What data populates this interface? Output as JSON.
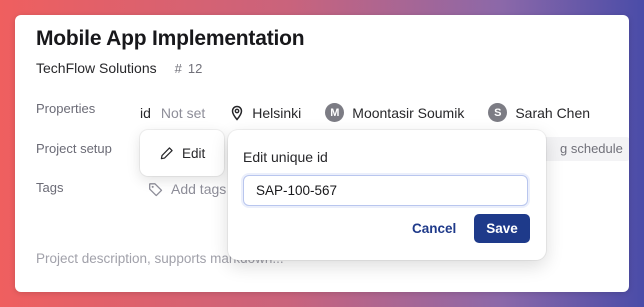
{
  "project": {
    "title": "Mobile App Implementation",
    "company": "TechFlow Solutions",
    "number_symbol": "#",
    "number": "12"
  },
  "labels": {
    "properties": "Properties",
    "project_setup": "Project setup",
    "tags": "Tags"
  },
  "properties": {
    "id_label": "id",
    "id_value": "Not set",
    "location": "Helsinki",
    "assignee_1": {
      "initial": "M",
      "name": "Moontasir Soumik"
    },
    "assignee_2": {
      "initial": "S",
      "name": "Sarah Chen"
    }
  },
  "setup": {
    "schedule_chip": "g schedule"
  },
  "tags": {
    "add_label": "Add tags"
  },
  "description": {
    "placeholder": "Project description, supports markdown..."
  },
  "edit_menu": {
    "edit_label": "Edit"
  },
  "id_editor": {
    "title": "Edit unique id",
    "value": "SAP-100-567",
    "cancel_label": "Cancel",
    "save_label": "Save"
  },
  "colors": {
    "primary": "#1e3a8a",
    "avatar": "#7c7c84"
  },
  "icons": [
    "pin-icon",
    "tag-icon",
    "pencil-icon"
  ]
}
